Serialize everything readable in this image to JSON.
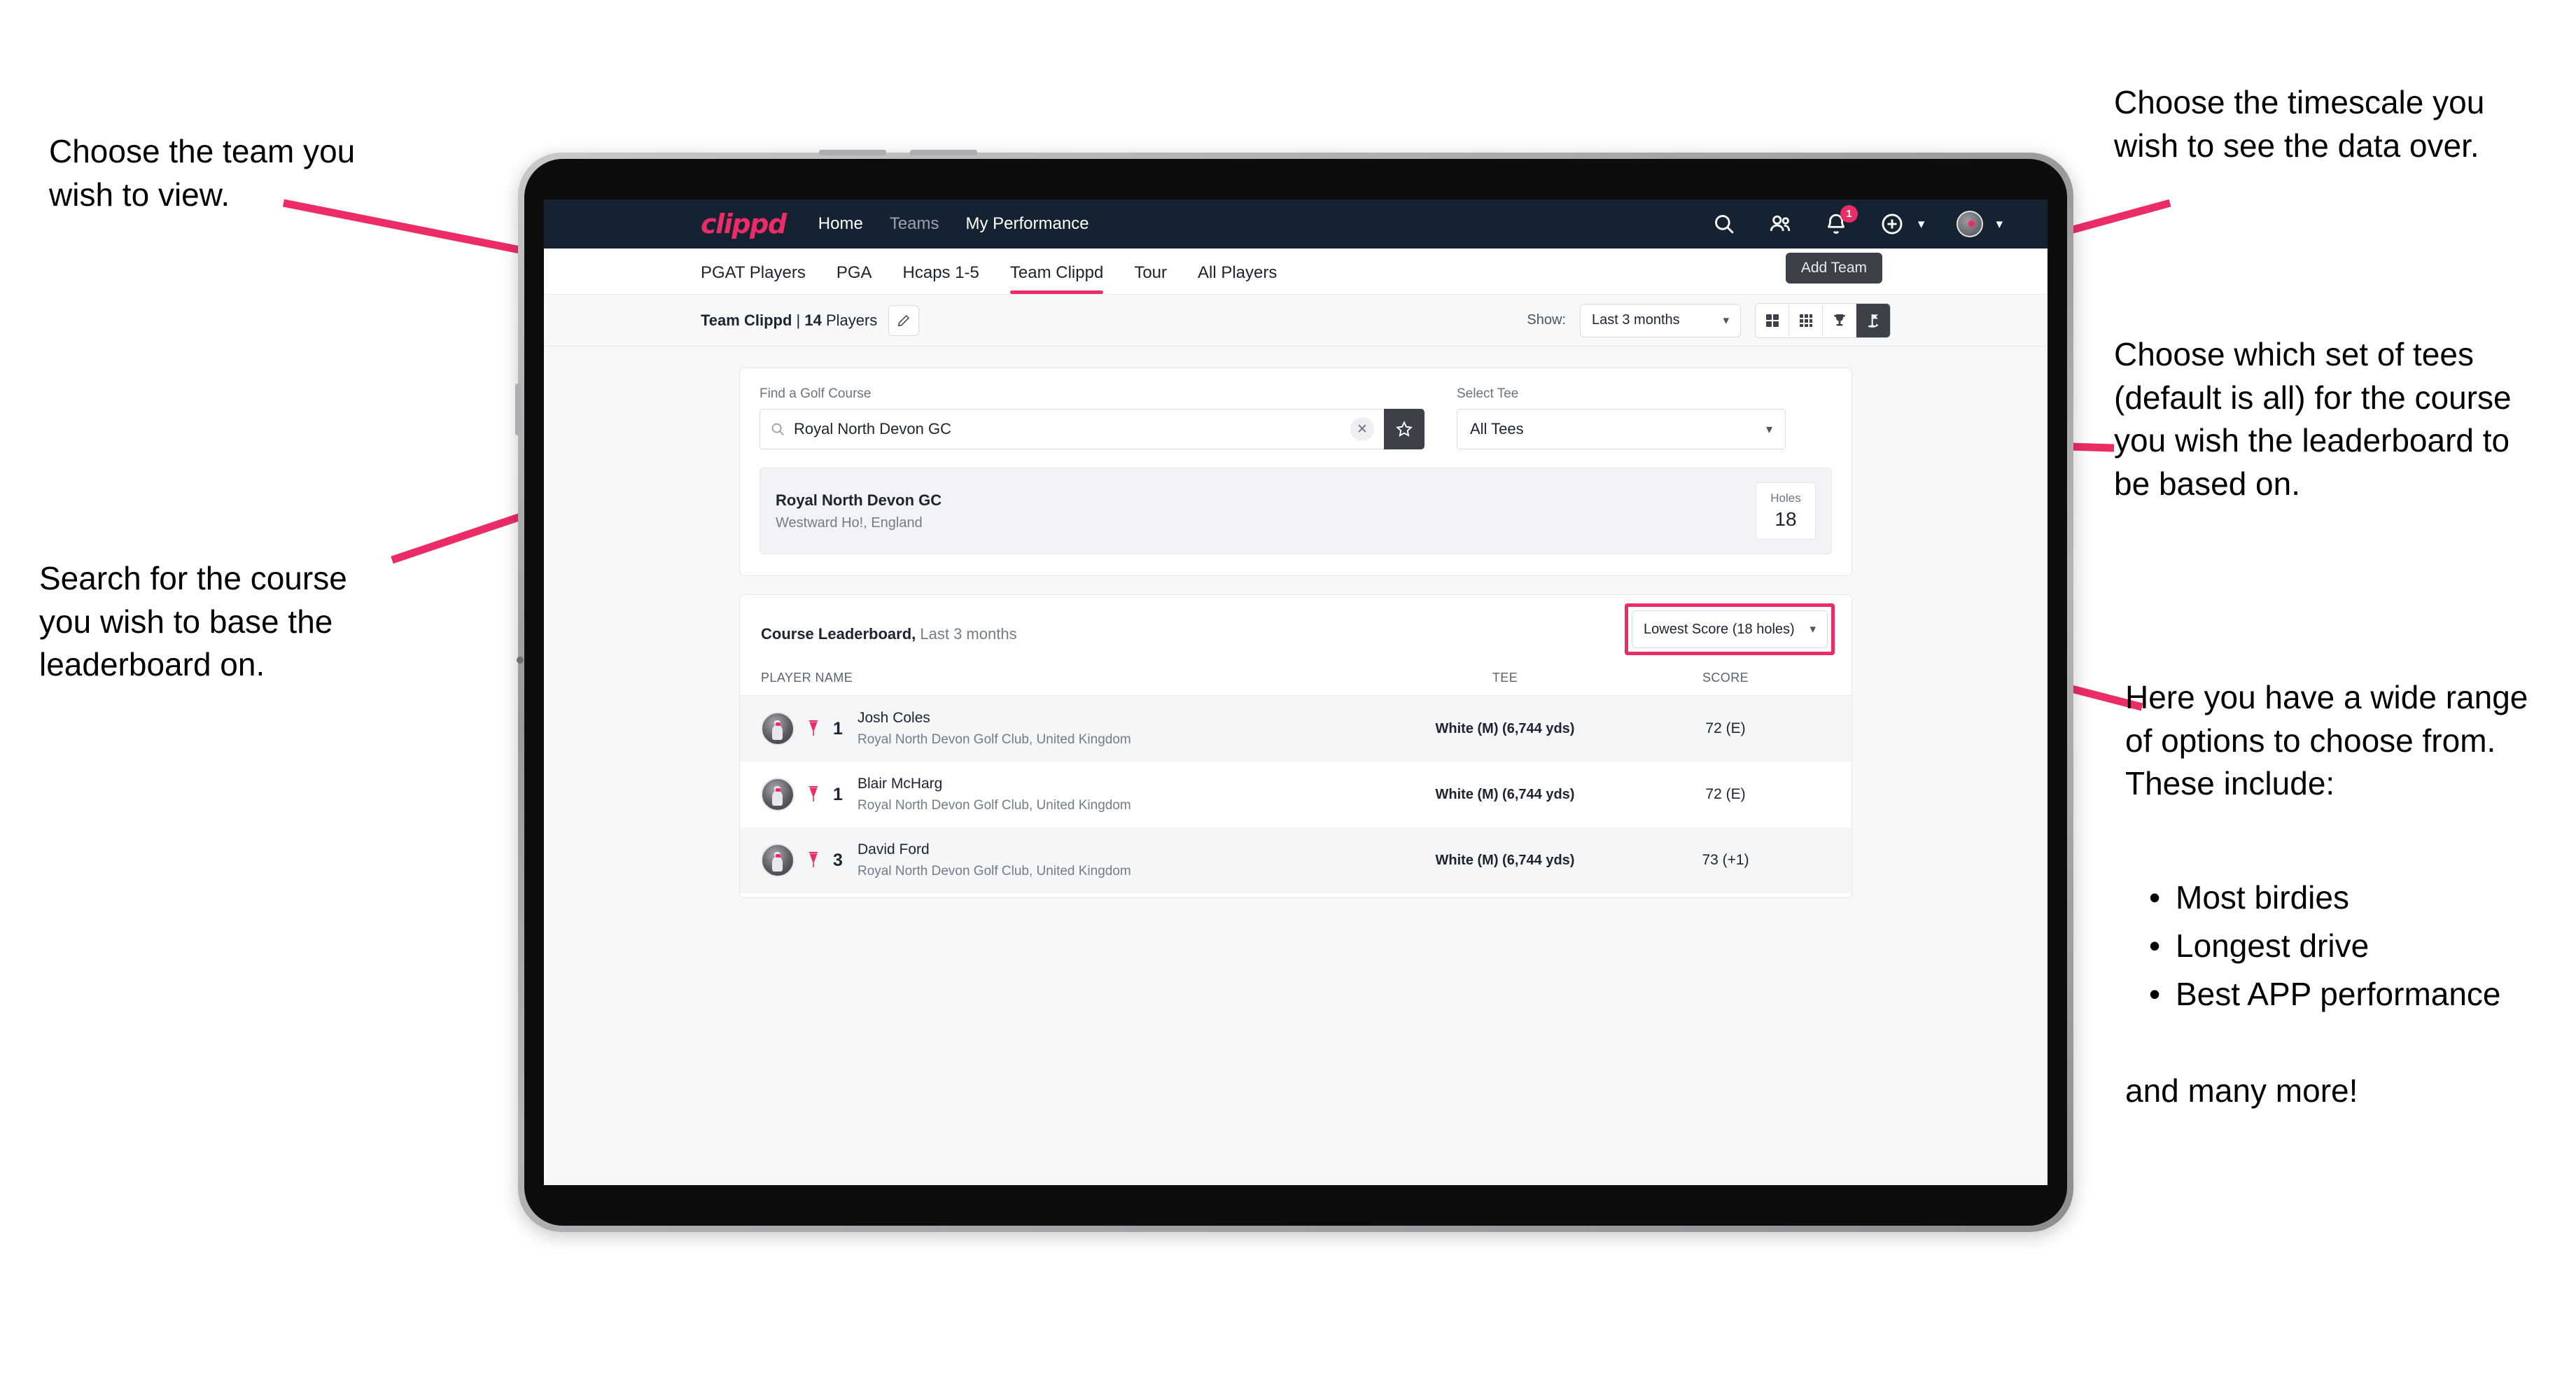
{
  "annotations": {
    "team": "Choose the team you\nwish to view.",
    "search": "Search for the course\nyou wish to base the\nleaderboard on.",
    "timescale": "Choose the timescale you\nwish to see the data over.",
    "tees": "Choose which set of tees\n(default is all) for the course\nyou wish the leaderboard to\nbe based on.",
    "options_intro": "Here you have a wide range\nof options to choose from.\nThese include:",
    "options_list": [
      "Most birdies",
      "Longest drive",
      "Best APP performance"
    ],
    "options_outro": "and many more!"
  },
  "navbar": {
    "logo": "clippd",
    "links": [
      {
        "label": "Home",
        "dim": false
      },
      {
        "label": "Teams",
        "dim": true
      },
      {
        "label": "My Performance",
        "dim": false
      }
    ],
    "icons": [
      {
        "name": "search-icon"
      },
      {
        "name": "people-icon"
      },
      {
        "name": "notifications-icon",
        "badge": "1"
      },
      {
        "name": "add-circle-icon"
      },
      {
        "name": "account-avatar"
      }
    ],
    "notification_count": "1"
  },
  "tabs": {
    "items": [
      {
        "label": "PGAT Players",
        "active": false,
        "dim": false
      },
      {
        "label": "PGA",
        "active": false,
        "dim": false
      },
      {
        "label": "Hcaps 1-5",
        "active": false,
        "dim": false
      },
      {
        "label": "Team Clippd",
        "active": true,
        "dim": true
      },
      {
        "label": "Tour",
        "active": false,
        "dim": false
      },
      {
        "label": "All Players",
        "active": false,
        "dim": false
      }
    ],
    "add_team_tooltip": "Add Team"
  },
  "toolbar": {
    "team_name": "Team Clippd",
    "separator": " | ",
    "player_count": "14",
    "players_word": " Players",
    "edit_icon": "pencil-icon",
    "show_label": "Show:",
    "period_value": "Last 3 months",
    "view_buttons": [
      {
        "name": "grid-2x2-view-button",
        "active": false
      },
      {
        "name": "grid-3x3-view-button",
        "active": false
      },
      {
        "name": "trophy-view-button",
        "active": false
      },
      {
        "name": "golf-flag-view-button",
        "active": true
      }
    ]
  },
  "search_card": {
    "course_label": "Find a Golf Course",
    "course_value": "Royal North Devon GC",
    "course_placeholder": "Find a Golf Course",
    "clear_glyph": "✕",
    "tee_label": "Select Tee",
    "tee_value": "All Tees",
    "result": {
      "name": "Royal North Devon GC",
      "location": "Westward Ho!, England",
      "holes_label": "Holes",
      "holes_value": "18"
    }
  },
  "leaderboard": {
    "title_bold": "Course Leaderboard,",
    "title_rest": " Last 3 months",
    "metric_value": "Lowest Score (18 holes)",
    "columns": [
      "PLAYER NAME",
      "TEE",
      "SCORE"
    ],
    "rows": [
      {
        "rank": "1",
        "name": "Josh Coles",
        "club": "Royal North Devon Golf Club, United Kingdom",
        "tee": "White (M) (6,744 yds)",
        "score": "72 (E)"
      },
      {
        "rank": "1",
        "name": "Blair McHarg",
        "club": "Royal North Devon Golf Club, United Kingdom",
        "tee": "White (M) (6,744 yds)",
        "score": "72 (E)"
      },
      {
        "rank": "3",
        "name": "David Ford",
        "club": "Royal North Devon Golf Club, United Kingdom",
        "tee": "White (M) (6,744 yds)",
        "score": "73 (+1)"
      }
    ]
  },
  "colors": {
    "accent_pink": "#ec2c67",
    "navbar_dark": "#152232",
    "dark_button": "#3c4049",
    "page_bg": "#f7f8fa"
  }
}
